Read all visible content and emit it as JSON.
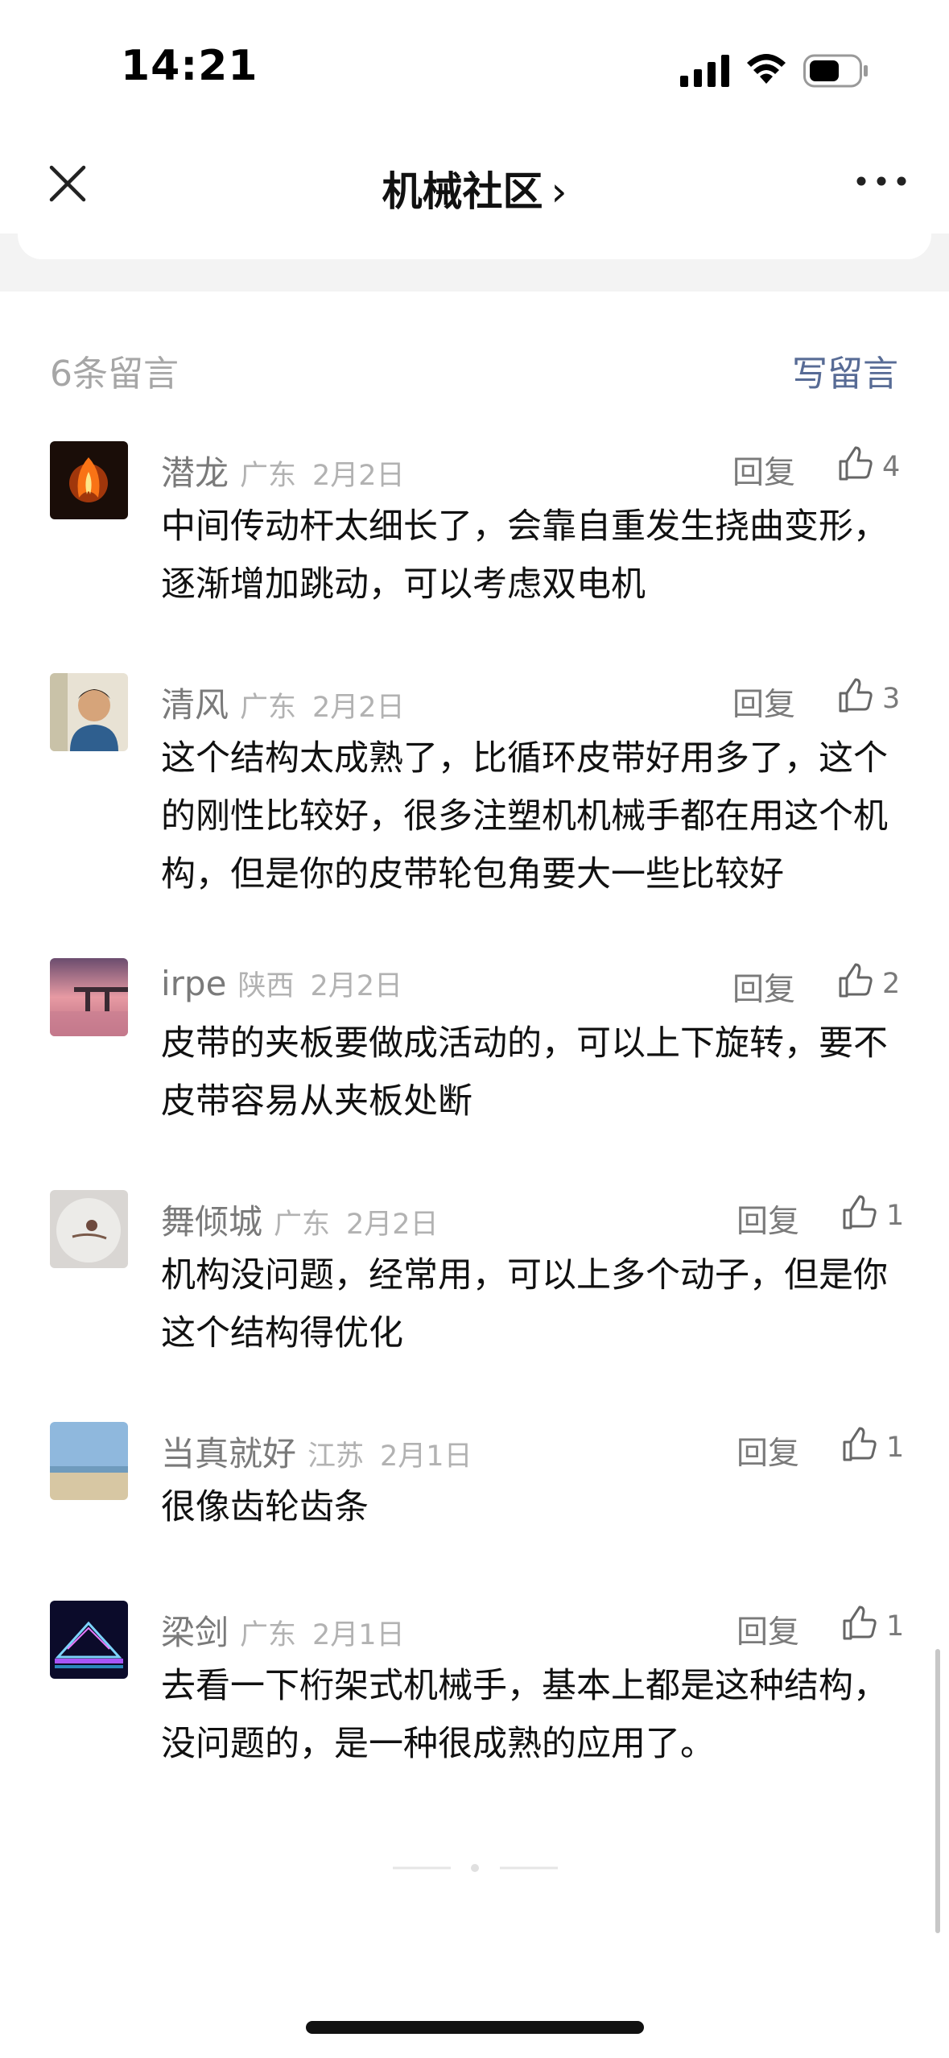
{
  "status_bar": {
    "time": "14:21"
  },
  "nav": {
    "title": "机械社区",
    "chevron": "›"
  },
  "comments_header": {
    "count_label": "6条留言",
    "write_label": "写留言"
  },
  "comments": [
    {
      "name": "潜龙",
      "location": "广东",
      "date": "2月2日",
      "reply": "回复",
      "likes": "4",
      "text": "中间传动杆太细长了，会靠自重发生挠曲变形，逐渐增加跳动，可以考虑双电机"
    },
    {
      "name": "清风",
      "location": "广东",
      "date": "2月2日",
      "reply": "回复",
      "likes": "3",
      "text": "这个结构太成熟了，比循环皮带好用多了，这个的刚性比较好，很多注塑机机械手都在用这个机构，但是你的皮带轮包角要大一些比较好"
    },
    {
      "name": "irpe",
      "location": "陕西",
      "date": "2月2日",
      "reply": "回复",
      "likes": "2",
      "text": "皮带的夹板要做成活动的，可以上下旋转，要不皮带容易从夹板处断"
    },
    {
      "name": "舞倾城",
      "location": "广东",
      "date": "2月2日",
      "reply": "回复",
      "likes": "1",
      "text": "机构没问题，经常用，可以上多个动子，但是你这个结构得优化"
    },
    {
      "name": "当真就好",
      "location": "江苏",
      "date": "2月1日",
      "reply": "回复",
      "likes": "1",
      "text": "很像齿轮齿条"
    },
    {
      "name": "梁剑",
      "location": "广东",
      "date": "2月1日",
      "reply": "回复",
      "likes": "1",
      "text": "去看一下桁架式机械手，基本上都是这种结构，没问题的，是一种很成熟的应用了。"
    }
  ],
  "icons": {
    "close": "close-icon",
    "more": "more-icon",
    "like": "thumbs-up-icon",
    "signal": "signal-icon",
    "wifi": "wifi-icon",
    "battery": "battery-icon"
  },
  "colors": {
    "link": "#576b95",
    "meta": "#b2b2b2",
    "secondary": "#7a7a7a"
  }
}
